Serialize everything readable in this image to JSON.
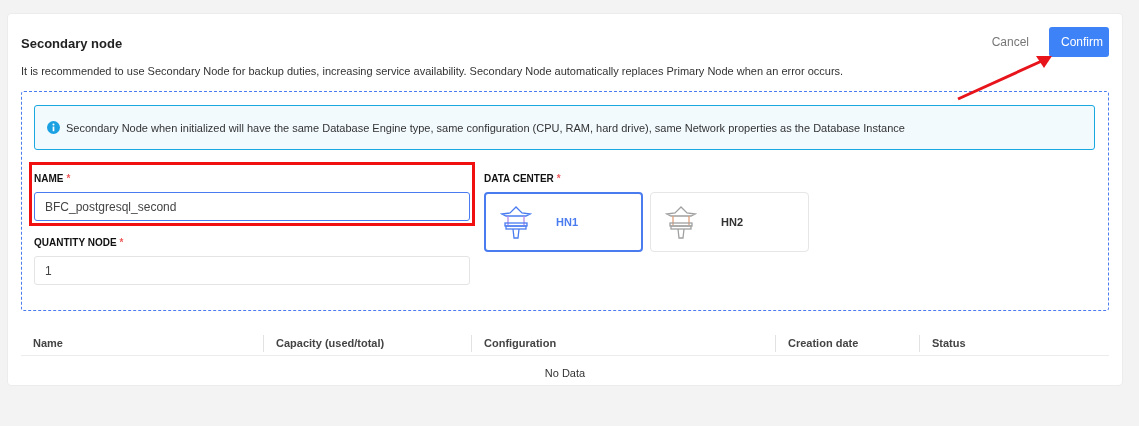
{
  "header": {
    "title": "Secondary node",
    "buttons": [
      {
        "label": "Cancel",
        "kind": "text"
      },
      {
        "label": "Confirm",
        "kind": "primary"
      }
    ]
  },
  "description": "It is recommended to use Secondary Node for backup duties, increasing service availability. Secondary Node automatically replaces Primary Node when an error occurs.",
  "info": "Secondary Node when initialized will have the same Database Engine type, same configuration (CPU, RAM, hard drive), same Network properties as the Database Instance",
  "name_field": {
    "label": "NAME",
    "required_mark": "*",
    "value": "BFC_postgresql_second",
    "focused": true
  },
  "quantity_field": {
    "label": "QUANTITY NODE",
    "required_mark": "*",
    "value": "1",
    "focused": false
  },
  "data_center": {
    "label": "DATA CENTER",
    "required_mark": "*",
    "options": [
      {
        "label": "HN1",
        "selected": true
      },
      {
        "label": "HN2",
        "selected": false
      }
    ]
  },
  "table": {
    "columns": [
      "Name",
      "Capacity (used/total)",
      "Configuration",
      "Creation date",
      "Status"
    ],
    "empty_text": "No Data"
  }
}
